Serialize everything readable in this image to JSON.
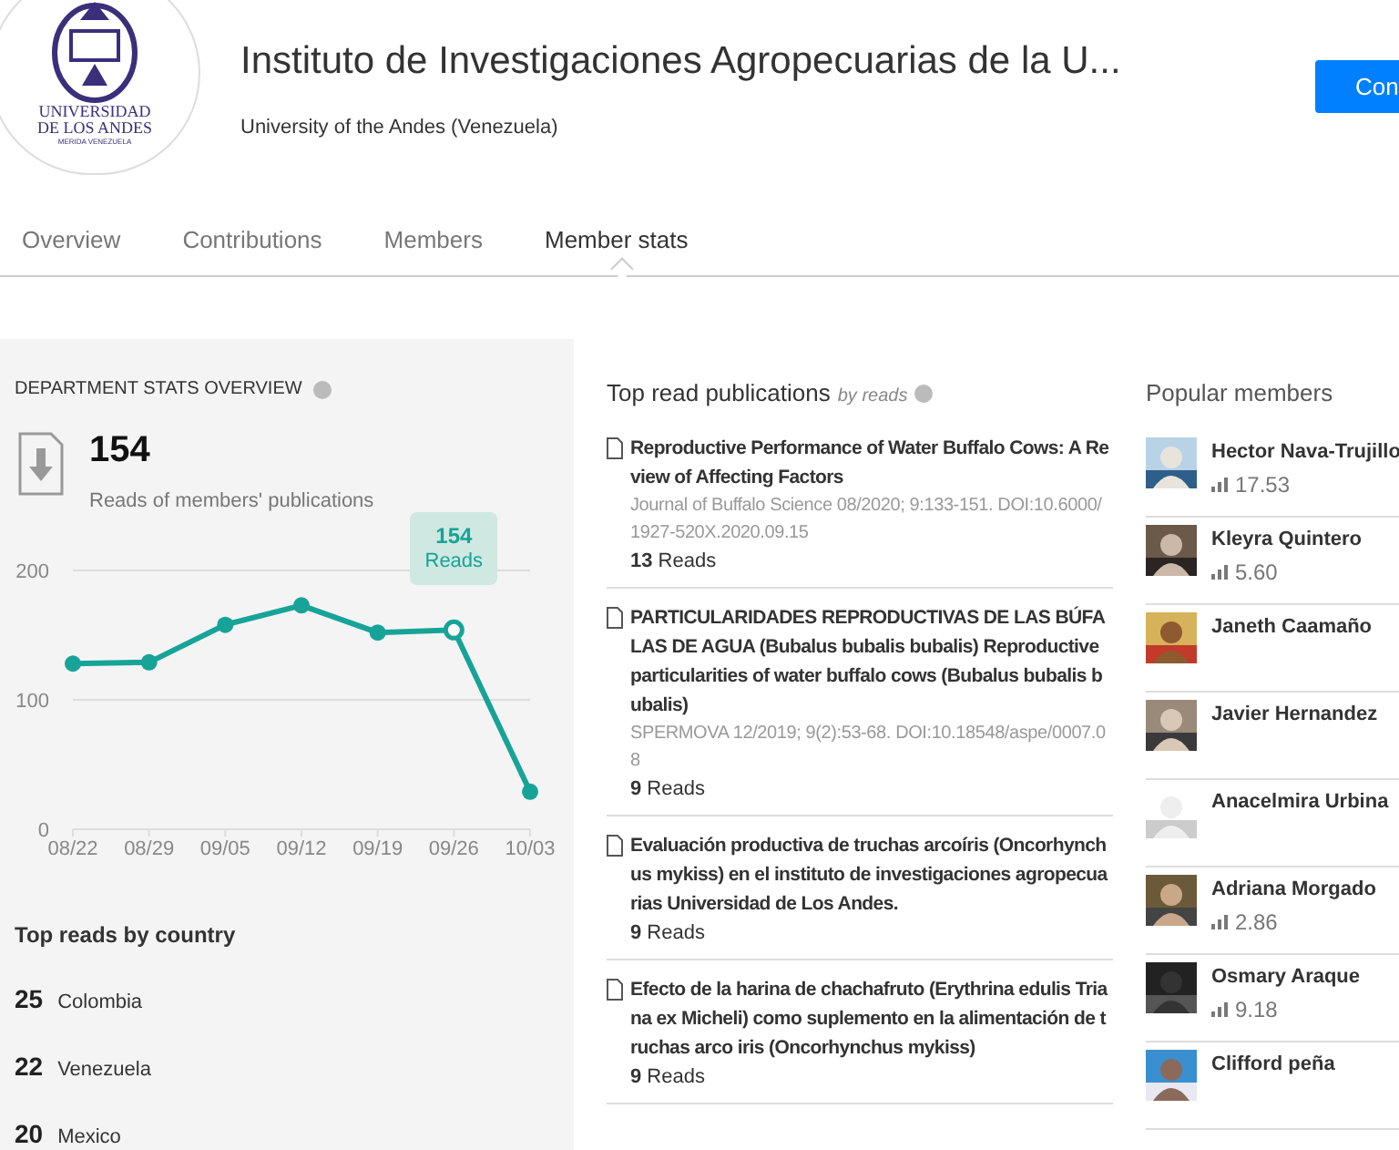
{
  "header": {
    "title": "Instituto de Investigaciones Agropecuarias de la U...",
    "subtitle": "University of the Andes (Venezuela)",
    "logo_text": [
      "UNIVERSIDAD",
      "DE LOS ANDES",
      "MERIDA VENEZUELA"
    ],
    "button": "Con"
  },
  "tabs": [
    {
      "label": "Overview",
      "selected": false
    },
    {
      "label": "Contributions",
      "selected": false
    },
    {
      "label": "Members",
      "selected": false
    },
    {
      "label": "Member stats",
      "selected": true
    }
  ],
  "stats": {
    "title": "DEPARTMENT STATS OVERVIEW",
    "total": "154",
    "total_label": "Reads of members' publications",
    "chart_data": {
      "type": "line",
      "categories": [
        "08/22",
        "08/29",
        "09/05",
        "09/12",
        "09/19",
        "09/26",
        "10/03"
      ],
      "series": [
        {
          "name": "Reads",
          "color": "#17a398",
          "marker": "circle",
          "values": [
            128,
            129,
            158,
            173,
            152,
            154,
            29
          ]
        }
      ],
      "ylim": [
        0,
        200
      ],
      "yticks": [
        0,
        100,
        200
      ],
      "annotations": [
        "154"
      ]
    },
    "countries_title": "Top reads by country",
    "countries": [
      {
        "count": "25",
        "name": "Colombia"
      },
      {
        "count": "22",
        "name": "Venezuela"
      },
      {
        "count": "20",
        "name": "Mexico"
      }
    ]
  },
  "publications": {
    "title": "Top read publications",
    "subtitle": "by reads",
    "items": [
      {
        "title": "Reproductive Performance of Water Buffalo Cows: A Review of Affecting Factors",
        "meta": "Journal of Buffalo Science 08/2020; 9:133-151. DOI:10.6000/1927-520X.2020.09.15",
        "reads": "13",
        "reads_label": "Reads"
      },
      {
        "title": "PARTICULARIDADES REPRODUCTIVAS DE LAS BÚFALAS DE AGUA (Bubalus bubalis bubalis) Reproductive particularities of water buffalo cows (Bubalus bubalis bubalis)",
        "meta": "SPERMOVA 12/2019; 9(2):53-68. DOI:10.18548/aspe/0007.08",
        "reads": "9",
        "reads_label": "Reads"
      },
      {
        "title": "Evaluación productiva de truchas arcoíris (Oncorhynchus mykiss) en el instituto de investigaciones agropecuarias Universidad de Los Andes.",
        "reads": "9",
        "reads_label": "Reads"
      },
      {
        "title": "Efecto de la harina de chachafruto (Erythrina edulis Triana ex Micheli) como suplemento en la alimentación de truchas arco iris (Oncorhynchus mykiss)",
        "reads": "9",
        "reads_label": "Reads"
      }
    ]
  },
  "members": {
    "title": "Popular members",
    "items": [
      {
        "name": "Hector Nava-Trujillo",
        "score": "17.53"
      },
      {
        "name": "Kleyra Quintero",
        "score": "5.60"
      },
      {
        "name": "Janeth Caamaño"
      },
      {
        "name": "Javier Hernandez"
      },
      {
        "name": "Anacelmira Urbina"
      },
      {
        "name": "Adriana Morgado",
        "score": "2.86"
      },
      {
        "name": "Osmary Araque",
        "score": "9.18"
      },
      {
        "name": "Clifford peña"
      }
    ]
  }
}
